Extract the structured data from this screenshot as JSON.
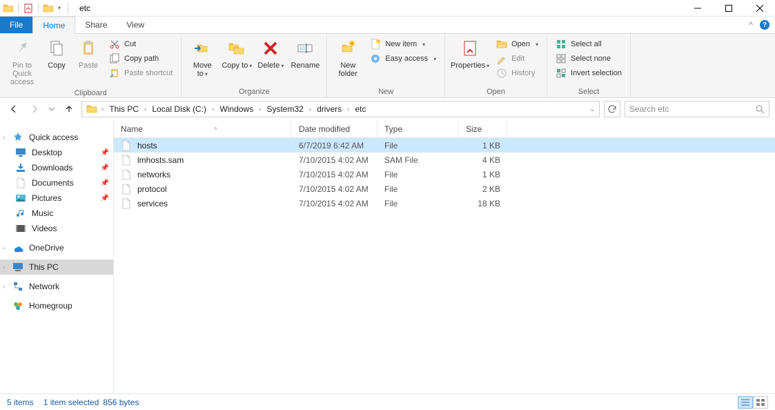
{
  "window": {
    "title": "etc"
  },
  "tabs": {
    "file": "File",
    "home": "Home",
    "share": "Share",
    "view": "View"
  },
  "ribbon": {
    "clipboard": {
      "label": "Clipboard",
      "pin": "Pin to Quick access",
      "copy": "Copy",
      "paste": "Paste",
      "cut": "Cut",
      "copy_path": "Copy path",
      "paste_shortcut": "Paste shortcut"
    },
    "organize": {
      "label": "Organize",
      "move_to": "Move to",
      "copy_to": "Copy to",
      "delete": "Delete",
      "rename": "Rename"
    },
    "new": {
      "label": "New",
      "new_folder": "New folder",
      "new_item": "New item",
      "easy_access": "Easy access"
    },
    "open": {
      "label": "Open",
      "properties": "Properties",
      "open": "Open",
      "edit": "Edit",
      "history": "History"
    },
    "select": {
      "label": "Select",
      "select_all": "Select all",
      "select_none": "Select none",
      "invert": "Invert selection"
    }
  },
  "breadcrumbs": [
    "This PC",
    "Local Disk (C:)",
    "Windows",
    "System32",
    "drivers",
    "etc"
  ],
  "search": {
    "placeholder": "Search etc"
  },
  "columns": {
    "name": "Name",
    "date": "Date modified",
    "type": "Type",
    "size": "Size"
  },
  "sidebar": {
    "quick_access": "Quick access",
    "desktop": "Desktop",
    "downloads": "Downloads",
    "documents": "Documents",
    "pictures": "Pictures",
    "music": "Music",
    "videos": "Videos",
    "onedrive": "OneDrive",
    "this_pc": "This PC",
    "network": "Network",
    "homegroup": "Homegroup"
  },
  "files": [
    {
      "name": "hosts",
      "date": "6/7/2019 6:42 AM",
      "type": "File",
      "size": "1 KB",
      "selected": true
    },
    {
      "name": "lmhosts.sam",
      "date": "7/10/2015 4:02 AM",
      "type": "SAM File",
      "size": "4 KB",
      "selected": false
    },
    {
      "name": "networks",
      "date": "7/10/2015 4:02 AM",
      "type": "File",
      "size": "1 KB",
      "selected": false
    },
    {
      "name": "protocol",
      "date": "7/10/2015 4:02 AM",
      "type": "File",
      "size": "2 KB",
      "selected": false
    },
    {
      "name": "services",
      "date": "7/10/2015 4:02 AM",
      "type": "File",
      "size": "18 KB",
      "selected": false
    }
  ],
  "status": {
    "count": "5 items",
    "selected": "1 item selected",
    "bytes": "856 bytes"
  }
}
